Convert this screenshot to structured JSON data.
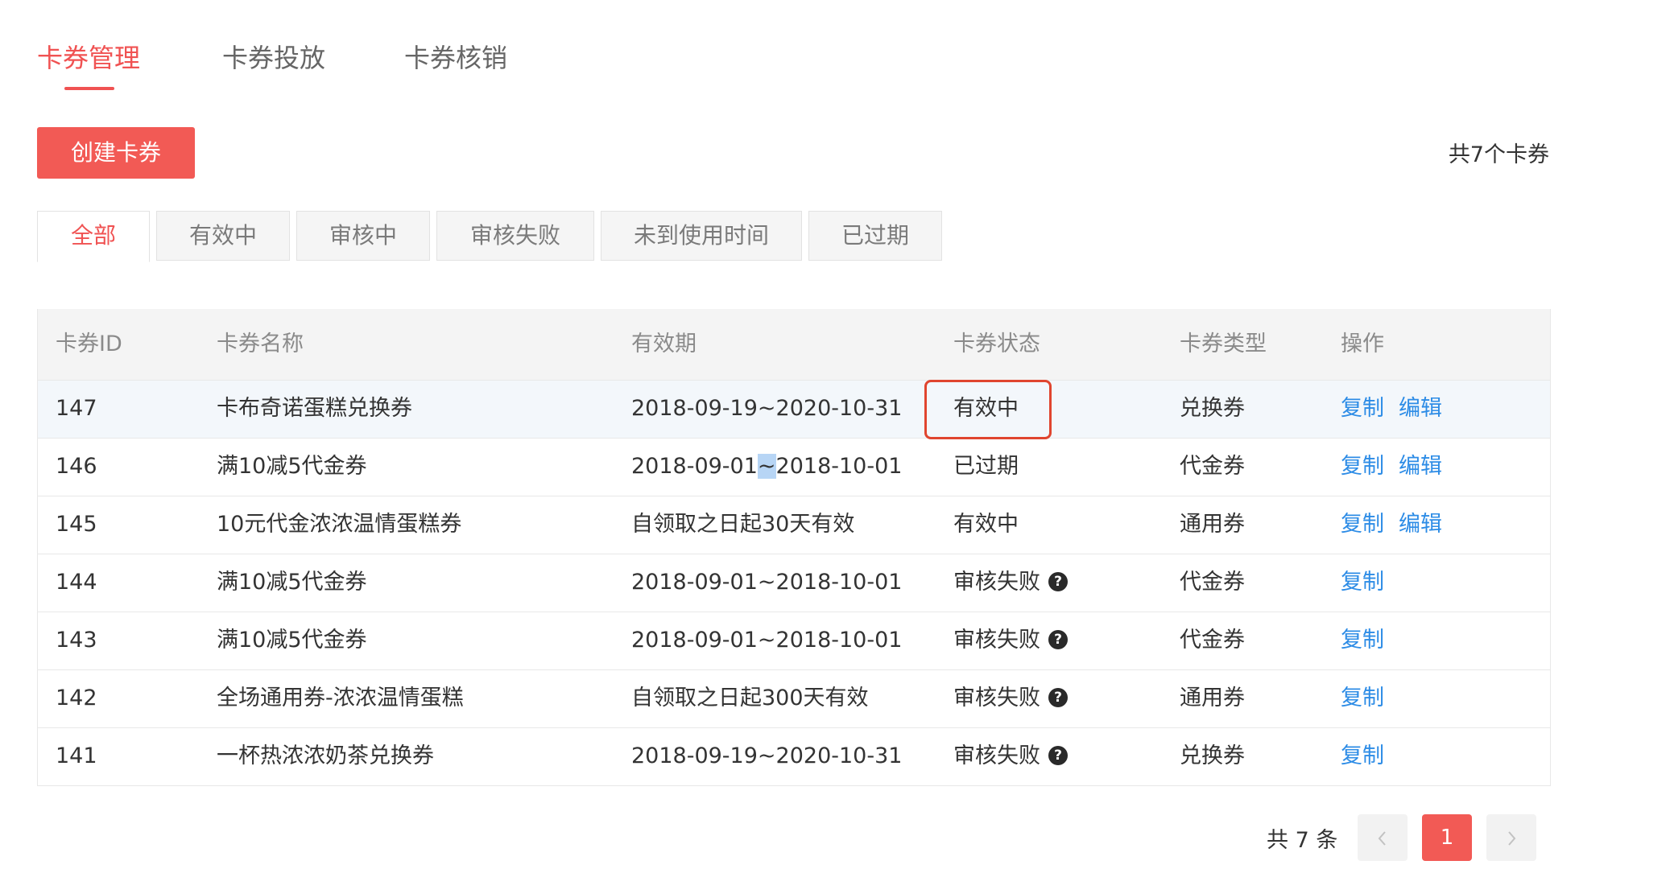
{
  "top_tabs": [
    {
      "label": "卡券管理",
      "active": true
    },
    {
      "label": "卡券投放",
      "active": false
    },
    {
      "label": "卡券核销",
      "active": false
    }
  ],
  "toolbar": {
    "create_label": "创建卡券",
    "total_text": "共7个卡券"
  },
  "filter_tabs": [
    {
      "label": "全部",
      "active": true
    },
    {
      "label": "有效中",
      "active": false
    },
    {
      "label": "审核中",
      "active": false
    },
    {
      "label": "审核失败",
      "active": false
    },
    {
      "label": "未到使用时间",
      "active": false
    },
    {
      "label": "已过期",
      "active": false
    }
  ],
  "table": {
    "headers": [
      "卡券ID",
      "卡券名称",
      "有效期",
      "卡券状态",
      "卡券类型",
      "操作"
    ],
    "rows": [
      {
        "id": "147",
        "name": "卡布奇诺蛋糕兑换券",
        "validity": "2018-09-19~2020-10-31",
        "status": "有效中",
        "type": "兑换券",
        "actions": [
          "复制",
          "编辑"
        ],
        "status_help": false
      },
      {
        "id": "146",
        "name": "满10减5代金券",
        "validity": "2018-09-01~2018-10-01",
        "status": "已过期",
        "type": "代金券",
        "actions": [
          "复制",
          "编辑"
        ],
        "status_help": false
      },
      {
        "id": "145",
        "name": "10元代金浓浓温情蛋糕券",
        "validity": "自领取之日起30天有效",
        "status": "有效中",
        "type": "通用券",
        "actions": [
          "复制",
          "编辑"
        ],
        "status_help": false
      },
      {
        "id": "144",
        "name": "满10减5代金券",
        "validity": "2018-09-01~2018-10-01",
        "status": "审核失败",
        "type": "代金券",
        "actions": [
          "复制"
        ],
        "status_help": true
      },
      {
        "id": "143",
        "name": "满10减5代金券",
        "validity": "2018-09-01~2018-10-01",
        "status": "审核失败",
        "type": "代金券",
        "actions": [
          "复制"
        ],
        "status_help": true
      },
      {
        "id": "142",
        "name": "全场通用券-浓浓温情蛋糕",
        "validity": "自领取之日起300天有效",
        "status": "审核失败",
        "type": "通用券",
        "actions": [
          "复制"
        ],
        "status_help": true
      },
      {
        "id": "141",
        "name": "一杯热浓浓奶茶兑换券",
        "validity": "2018-09-19~2020-10-31",
        "status": "审核失败",
        "type": "兑换券",
        "actions": [
          "复制"
        ],
        "status_help": true
      }
    ]
  },
  "pagination": {
    "total_text": "共 7 条",
    "current_page": "1",
    "prev_icon": "chevron-left-icon",
    "next_icon": "chevron-right-icon"
  },
  "colors": {
    "accent": "#f25a55",
    "link": "#2d8ce6",
    "highlight_border": "#e0452f"
  }
}
